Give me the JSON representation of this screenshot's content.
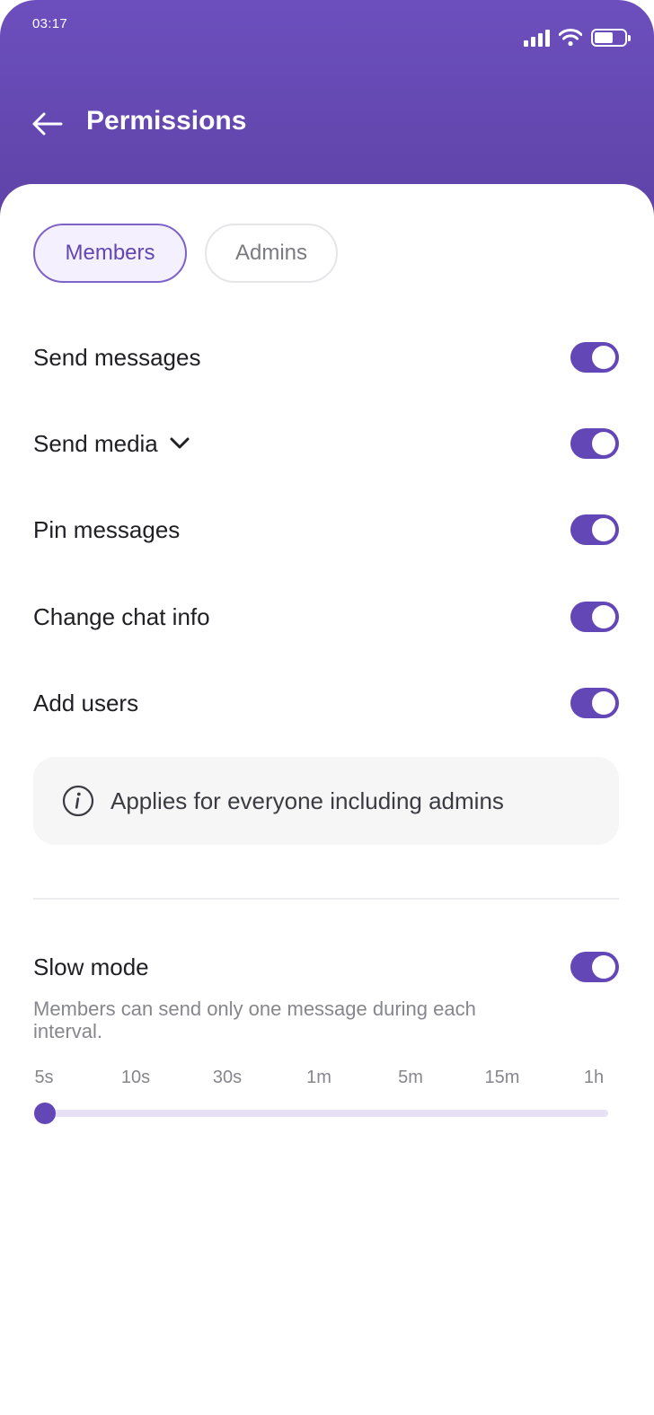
{
  "status_bar": {
    "time": "03:17",
    "battery_level": 0.62
  },
  "header": {
    "title": "Permissions"
  },
  "tabs": [
    {
      "label": "Members",
      "active": true
    },
    {
      "label": "Admins",
      "active": false
    }
  ],
  "permissions": [
    {
      "label": "Send messages",
      "enabled": true,
      "expandable": false
    },
    {
      "label": "Send media",
      "enabled": true,
      "expandable": true
    },
    {
      "label": "Pin messages",
      "enabled": true,
      "expandable": false
    },
    {
      "label": "Change chat info",
      "enabled": true,
      "expandable": false
    },
    {
      "label": "Add users",
      "enabled": true,
      "expandable": false
    }
  ],
  "info": {
    "text": "Applies for everyone including admins",
    "icon": "info-icon"
  },
  "slow_mode": {
    "label": "Slow mode",
    "enabled": true,
    "description": "Members can send only one message during each interval.",
    "intervals": [
      "5s",
      "10s",
      "30s",
      "1m",
      "5m",
      "15m",
      "1h"
    ],
    "selected_index": 0
  },
  "colors": {
    "accent": "#6447b6",
    "header": "#6c4fbd",
    "track": "#e7e1f7"
  }
}
